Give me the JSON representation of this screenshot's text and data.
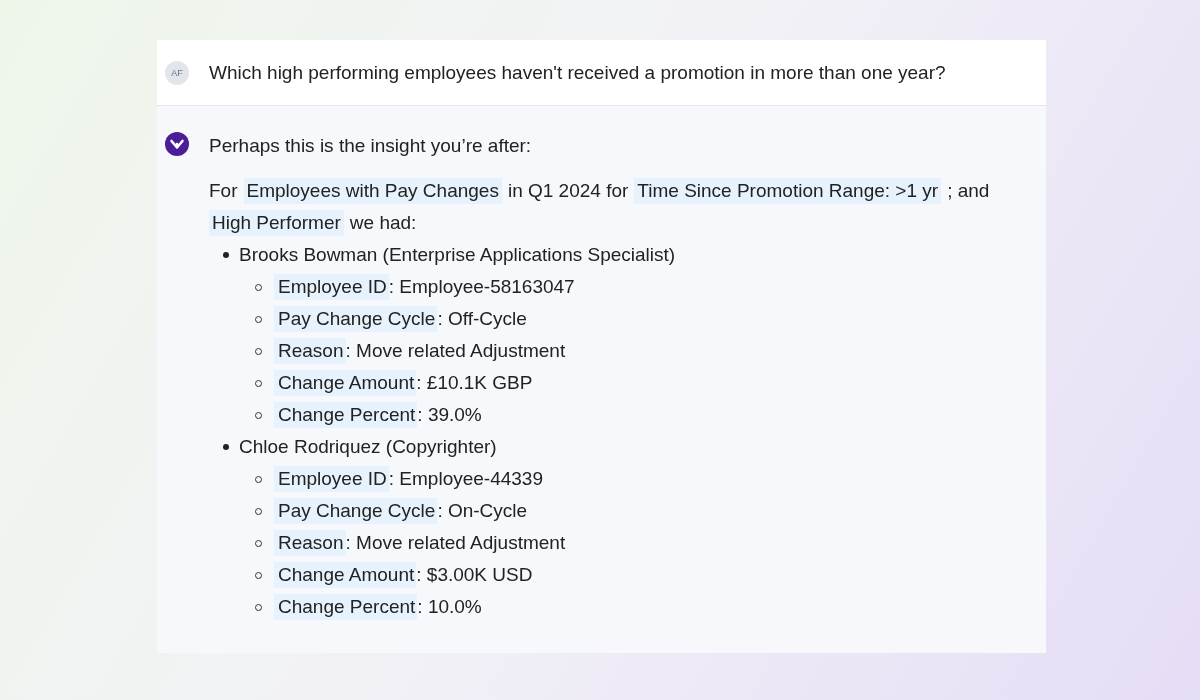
{
  "question": {
    "avatar": "AF",
    "text": "Which high performing employees haven't received a promotion in more than one year?"
  },
  "answer": {
    "intro": "Perhaps this is the insight you’re after:",
    "summary": [
      {
        "text": "For",
        "highlighted": false
      },
      {
        "text": "Employees with Pay Changes",
        "highlighted": true
      },
      {
        "text": "in Q1 2024 for",
        "highlighted": false
      },
      {
        "text": "Time Since Promotion Range: >1 yr",
        "highlighted": true
      },
      {
        "text": "; and",
        "highlighted": false
      },
      {
        "text": "High Performer",
        "highlighted": true
      },
      {
        "text": "we had:",
        "highlighted": false
      }
    ],
    "employees": [
      {
        "name": "Brooks Bowman (Enterprise Applications Specialist)",
        "fields": [
          {
            "label": "Employee ID",
            "value": ": Employee-58163047"
          },
          {
            "label": "Pay Change Cycle",
            "value": ": Off-Cycle"
          },
          {
            "label": "Reason",
            "value": ": Move related Adjustment"
          },
          {
            "label": "Change Amount",
            "value": ": £10.1K GBP"
          },
          {
            "label": "Change Percent",
            "value": ": 39.0%"
          }
        ]
      },
      {
        "name": "Chloe Rodriquez (Copyrighter)",
        "fields": [
          {
            "label": "Employee ID",
            "value": ": Employee-44339"
          },
          {
            "label": "Pay Change Cycle",
            "value": ": On-Cycle"
          },
          {
            "label": "Reason",
            "value": ": Move related Adjustment"
          },
          {
            "label": "Change Amount",
            "value": ": $3.00K USD"
          },
          {
            "label": "Change Percent",
            "value": ": 10.0%"
          }
        ]
      }
    ]
  }
}
